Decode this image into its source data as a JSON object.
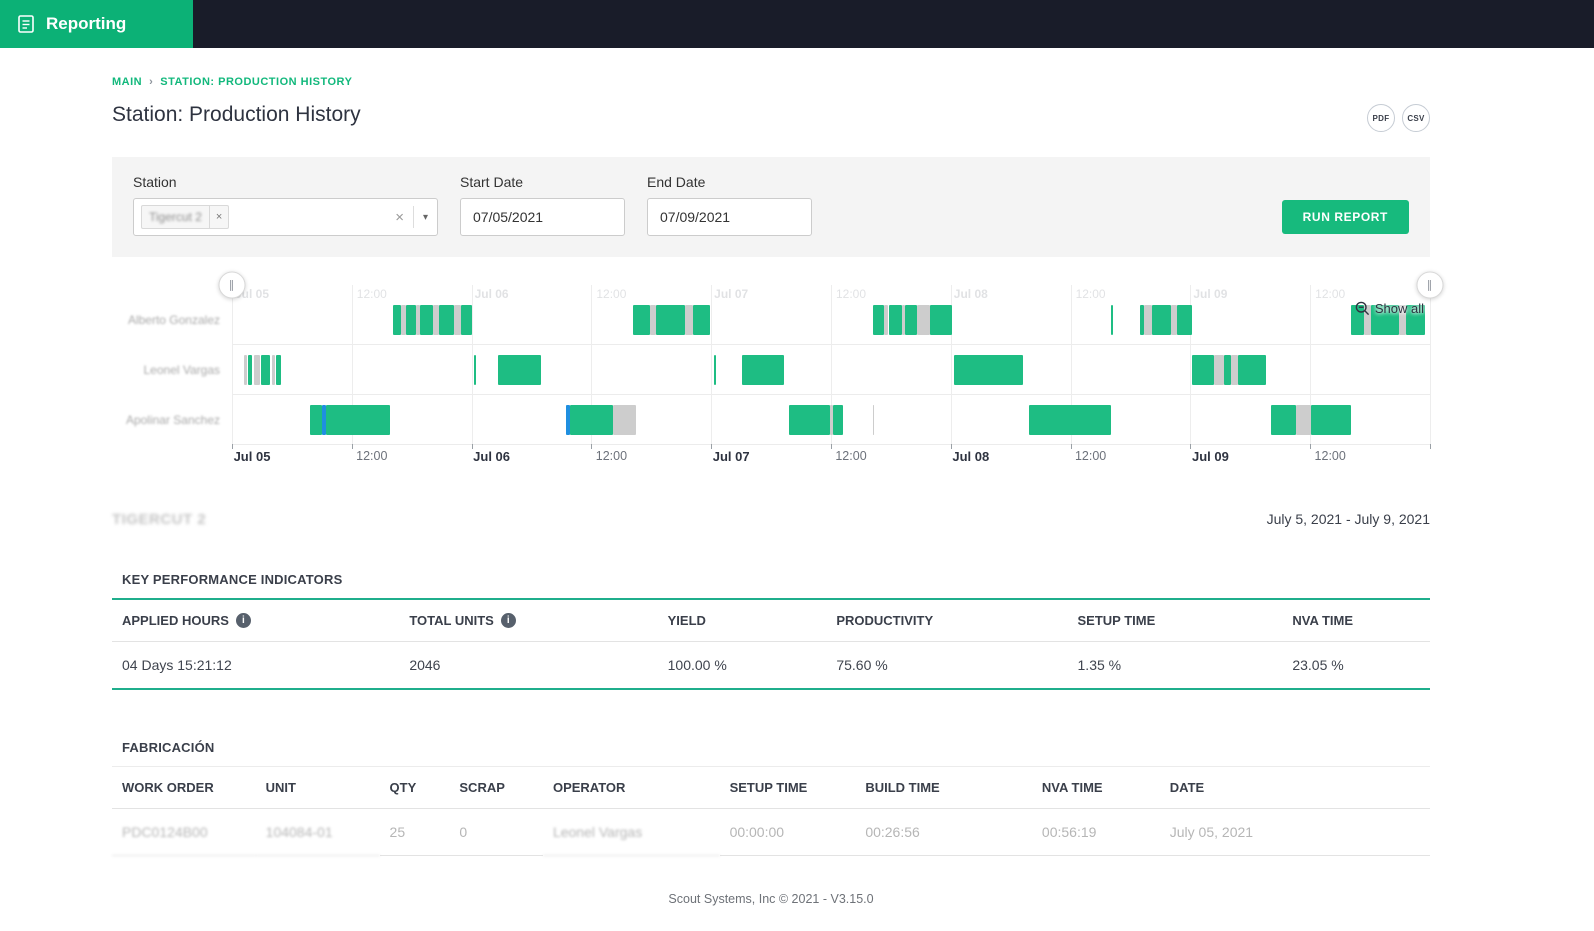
{
  "app": {
    "title": "Reporting"
  },
  "icons": {
    "close": "×",
    "caret": "▾",
    "chevron": "›",
    "handle": "∥",
    "info": "i"
  },
  "breadcrumb": {
    "items": [
      "MAIN",
      "STATION: PRODUCTION HISTORY"
    ]
  },
  "page": {
    "title": "Station: Production History"
  },
  "export": {
    "pdf": "PDF",
    "csv": "CSV"
  },
  "filters": {
    "station_label": "Station",
    "station_tag": "Tigercut 2",
    "start_date_label": "Start Date",
    "start_date_value": "07/05/2021",
    "end_date_label": "End Date",
    "end_date_value": "07/09/2021",
    "run_report": "RUN REPORT"
  },
  "gantt": {
    "show_all": "Show all",
    "rows": [
      {
        "name": "Alberto Gonzalez"
      },
      {
        "name": "Leonel Vargas"
      },
      {
        "name": "Apolinar Sanchez"
      }
    ],
    "axis": [
      "Jul 05",
      "12:00",
      "Jul 06",
      "12:00",
      "Jul 07",
      "12:00",
      "Jul 08",
      "12:00",
      "Jul 09",
      "12:00"
    ],
    "colors": {
      "run": "#1ebd83",
      "nva": "#cdcdcd",
      "setup": "#1f8fe0"
    },
    "segments": [
      [
        0,
        13.4,
        0.7,
        "g"
      ],
      [
        0,
        14.1,
        0.4,
        "gray"
      ],
      [
        0,
        14.5,
        0.9,
        "g"
      ],
      [
        0,
        15.4,
        0.3,
        "gray"
      ],
      [
        0,
        15.7,
        1.1,
        "g"
      ],
      [
        0,
        16.8,
        0.5,
        "gray"
      ],
      [
        0,
        17.3,
        1.2,
        "g"
      ],
      [
        0,
        18.5,
        0.6,
        "gray"
      ],
      [
        0,
        19.1,
        0.9,
        "g"
      ],
      [
        0,
        33.5,
        1.4,
        "g"
      ],
      [
        0,
        34.9,
        0.5,
        "gray"
      ],
      [
        0,
        35.4,
        2.4,
        "g"
      ],
      [
        0,
        37.8,
        0.7,
        "gray"
      ],
      [
        0,
        38.5,
        1.4,
        "g"
      ],
      [
        0,
        53.5,
        0.9,
        "g"
      ],
      [
        0,
        54.4,
        0.4,
        "gray"
      ],
      [
        0,
        54.8,
        1.1,
        "g"
      ],
      [
        0,
        55.9,
        0.3,
        "gray"
      ],
      [
        0,
        56.2,
        1.0,
        "g"
      ],
      [
        0,
        57.2,
        1.1,
        "gray"
      ],
      [
        0,
        58.3,
        1.8,
        "g"
      ],
      [
        0,
        73.4,
        0.15,
        "g"
      ],
      [
        0,
        75.8,
        0.3,
        "g"
      ],
      [
        0,
        76.1,
        0.7,
        "gray"
      ],
      [
        0,
        76.8,
        1.6,
        "g"
      ],
      [
        0,
        78.4,
        0.5,
        "gray"
      ],
      [
        0,
        78.9,
        1.2,
        "g"
      ],
      [
        0,
        93.4,
        1.1,
        "g"
      ],
      [
        0,
        94.5,
        0.6,
        "gray"
      ],
      [
        0,
        95.1,
        2.3,
        "g"
      ],
      [
        0,
        97.4,
        0.6,
        "gray"
      ],
      [
        0,
        98.0,
        1.6,
        "g"
      ],
      [
        1,
        1.0,
        0.25,
        "gray"
      ],
      [
        1,
        1.35,
        0.35,
        "g"
      ],
      [
        1,
        1.8,
        0.5,
        "gray"
      ],
      [
        1,
        2.4,
        0.8,
        "g"
      ],
      [
        1,
        3.3,
        0.3,
        "gray"
      ],
      [
        1,
        3.7,
        0.4,
        "g"
      ],
      [
        1,
        20.2,
        0.15,
        "g"
      ],
      [
        1,
        22.2,
        3.6,
        "g"
      ],
      [
        1,
        40.2,
        0.18,
        "g"
      ],
      [
        1,
        42.6,
        3.5,
        "g"
      ],
      [
        1,
        60.3,
        5.7,
        "g"
      ],
      [
        1,
        80.1,
        1.9,
        "g"
      ],
      [
        1,
        82.0,
        0.8,
        "gray"
      ],
      [
        1,
        82.8,
        0.6,
        "g"
      ],
      [
        1,
        83.4,
        0.6,
        "gray"
      ],
      [
        1,
        84.0,
        2.3,
        "g"
      ],
      [
        2,
        6.5,
        1.0,
        "g"
      ],
      [
        2,
        7.5,
        0.35,
        "blue"
      ],
      [
        2,
        7.85,
        5.35,
        "g"
      ],
      [
        2,
        27.9,
        0.35,
        "blue"
      ],
      [
        2,
        28.25,
        3.55,
        "g"
      ],
      [
        2,
        31.8,
        1.9,
        "gray"
      ],
      [
        2,
        46.5,
        3.4,
        "g"
      ],
      [
        2,
        49.9,
        0.3,
        "gray"
      ],
      [
        2,
        50.2,
        0.8,
        "g"
      ],
      [
        2,
        53.5,
        0.12,
        "gray"
      ],
      [
        2,
        66.5,
        6.9,
        "g"
      ],
      [
        2,
        86.7,
        2.1,
        "g"
      ],
      [
        2,
        88.8,
        1.3,
        "gray"
      ],
      [
        2,
        90.1,
        3.3,
        "g"
      ]
    ]
  },
  "summary": {
    "station_name": "TIGERCUT 2",
    "date_range": "July 5, 2021 - July 9, 2021"
  },
  "kpi": {
    "title": "KEY PERFORMANCE INDICATORS",
    "columns": [
      {
        "label": "APPLIED HOURS",
        "info": true
      },
      {
        "label": "TOTAL UNITS",
        "info": true
      },
      {
        "label": "YIELD"
      },
      {
        "label": "PRODUCTIVITY"
      },
      {
        "label": "SETUP TIME"
      },
      {
        "label": "NVA TIME"
      }
    ],
    "values": [
      "04 Days 15:21:12",
      "2046",
      "100.00 %",
      "75.60 %",
      "1.35 %",
      "23.05 %"
    ]
  },
  "fabrication": {
    "title": "FABRICACIÓN",
    "headers": [
      "WORK ORDER",
      "UNIT",
      "QTY",
      "SCRAP",
      "OPERATOR",
      "SETUP TIME",
      "BUILD TIME",
      "NVA TIME",
      "DATE"
    ],
    "redacted_columns": [
      0,
      1,
      4
    ],
    "rows": [
      [
        "PDC0124B00",
        "104084-01",
        "25",
        "0",
        "Leonel Vargas",
        "00:00:00",
        "00:26:56",
        "00:56:19",
        "July 05, 2021"
      ]
    ]
  },
  "footer": {
    "text": "Scout Systems, Inc © 2021 - V3.15.0"
  }
}
